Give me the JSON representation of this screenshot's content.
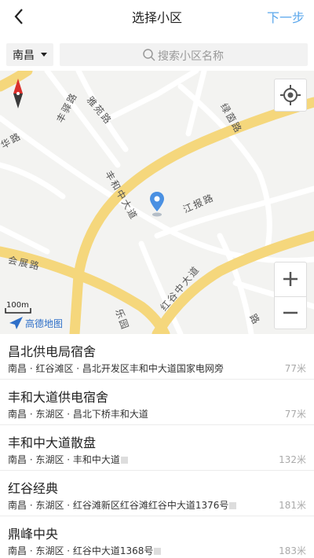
{
  "header": {
    "title": "选择小区",
    "next_label": "下一步",
    "back_icon": "chevron-left-icon"
  },
  "search": {
    "city": "南昌",
    "placeholder": "搜索小区名称"
  },
  "map": {
    "scale_label": "100m",
    "logo_text": "高德地图",
    "street_labels": [
      "丰驿路",
      "雅苑路",
      "绿茵路",
      "丰和中大道",
      "江报路",
      "会展路",
      "红谷中大道",
      "华路",
      "路",
      "乐园"
    ],
    "colors": {
      "major_road": "#f5d77c",
      "minor_road": "#ffffff",
      "background": "#f3f3f1",
      "pin": "#4a90e2"
    }
  },
  "communities": [
    {
      "name": "昌北供电局宿舍",
      "address": "南昌 · 红谷滩区 · 昌北开发区丰和中大道国家电网旁",
      "distance": "77米",
      "has_icon": false
    },
    {
      "name": "丰和大道供电宿舍",
      "address": "南昌 · 东湖区 · 昌北下桥丰和大道",
      "distance": "77米",
      "has_icon": false
    },
    {
      "name": "丰和中大道散盘",
      "address": "南昌 · 东湖区 · 丰和中大道",
      "distance": "132米",
      "has_icon": true
    },
    {
      "name": "红谷经典",
      "address": "南昌 · 东湖区 · 红谷滩新区红谷滩红谷中大道1376号",
      "distance": "181米",
      "has_icon": true
    },
    {
      "name": "鼎峰中央",
      "address": "南昌 · 东湖区 · 红谷中大道1368号",
      "distance": "183米",
      "has_icon": true
    }
  ]
}
